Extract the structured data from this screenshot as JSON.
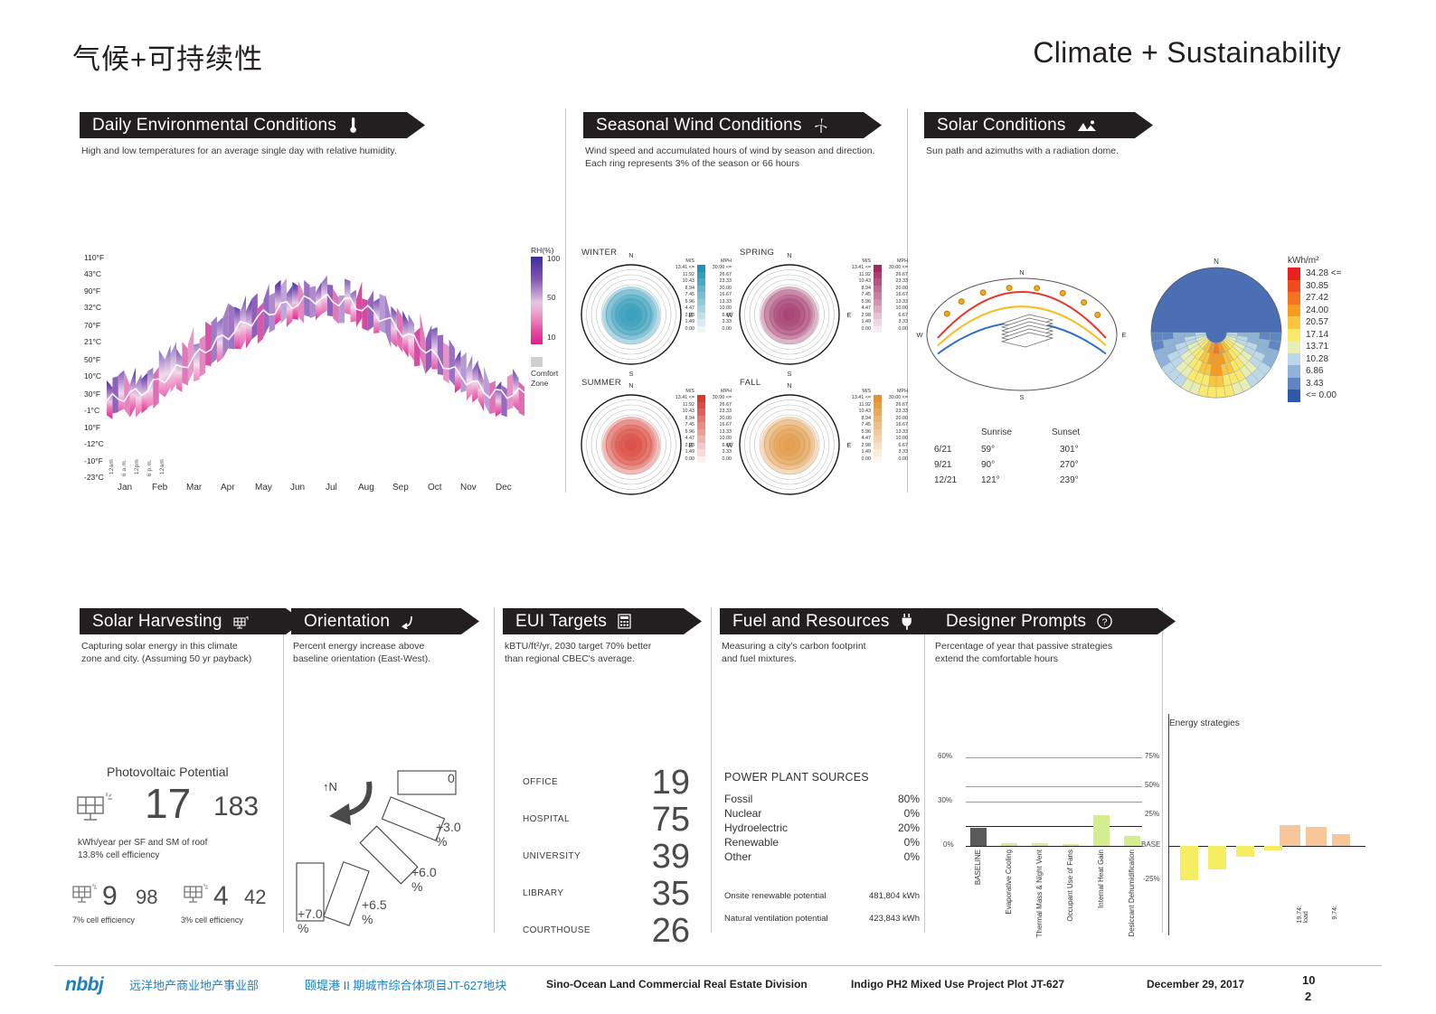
{
  "header": {
    "title_cn": "气候+可持续性",
    "title_en": "Climate + Sustainability"
  },
  "panels": {
    "daily": {
      "title": "Daily Environmental Conditions",
      "icon": "thermometer-icon",
      "subtitle": "High and low temperatures for an average single day with relative humidity."
    },
    "wind": {
      "title": "Seasonal Wind Conditions",
      "icon": "wind-turbine-icon",
      "subtitle": "Wind speed and accumulated hours of wind by season and direction.\nEach ring represents 3% of the season or 66 hours"
    },
    "solar": {
      "title": "Solar Conditions",
      "icon": "mountain-sun-icon",
      "subtitle": "Sun path and azimuths with a radiation dome."
    },
    "harvest": {
      "title": "Solar Harvesting",
      "icon": "solar-panel-icon",
      "subtitle": "Capturing solar energy in this climate\nzone and city. (Assuming 50 yr payback)"
    },
    "orientation": {
      "title": "Orientation",
      "icon": "rotate-arrow-icon",
      "subtitle": "Percent energy increase above\nbaseline orientation (East-West)."
    },
    "eui": {
      "title": "EUI Targets",
      "icon": "calculator-icon",
      "subtitle": "kBTU/ft²/yr, 2030 target 70% better\nthan regional CBEC's average."
    },
    "fuel": {
      "title": "Fuel and Resources",
      "icon": "plug-icon",
      "subtitle": "Measuring a city's carbon footprint\nand fuel mixtures."
    },
    "prompts": {
      "title": "Designer Prompts",
      "icon": "question-mark-icon",
      "subtitle": "Percentage of year that passive strategies\nextend the comfortable hours"
    }
  },
  "chart_data": [
    {
      "type": "area",
      "name": "daily-environmental-conditions",
      "title": "Daily Environmental Conditions",
      "xlabel": "",
      "ylabel": "Temperature",
      "y_ticks": [
        {
          "f": "110°F",
          "c": "43°C"
        },
        {
          "f": "90°F",
          "c": "32°C"
        },
        {
          "f": "70°F",
          "c": "21°C"
        },
        {
          "f": "50°F",
          "c": "10°C"
        },
        {
          "f": "30°F",
          "c": "-1°C"
        },
        {
          "f": "10°F",
          "c": "-12°C"
        },
        {
          "f": "-10°F",
          "c": "-23°C"
        }
      ],
      "categories": [
        "Jan",
        "Feb",
        "Mar",
        "Apr",
        "May",
        "Jun",
        "Jul",
        "Aug",
        "Sep",
        "Oct",
        "Nov",
        "Dec"
      ],
      "hour_ticks": [
        "12am",
        "6 a.m.",
        "12pm",
        "6 p.m.",
        "12am"
      ],
      "monthly_high_f": [
        34,
        40,
        52,
        66,
        78,
        86,
        89,
        87,
        79,
        66,
        50,
        38
      ],
      "monthly_low_f": [
        16,
        20,
        31,
        44,
        56,
        66,
        72,
        70,
        60,
        45,
        31,
        20
      ],
      "legend": {
        "title": "RH(%)",
        "ticks": [
          "100",
          "50",
          "10"
        ],
        "comfort_label": "Comfort\nZone"
      }
    },
    {
      "type": "windrose",
      "name": "seasonal-wind-conditions",
      "seasons": [
        "WINTER",
        "SPRING",
        "SUMMER",
        "FALL"
      ],
      "cardinals": [
        "N",
        "E",
        "S",
        "W"
      ],
      "ring_note": "Each ring represents 3% of the season or 66 hours",
      "legend_headers": [
        "M/S",
        "MPH"
      ],
      "ms_values": [
        "13.41 <=",
        "11.92",
        "10.43",
        "8.94",
        "7.45",
        "5.96",
        "4.47",
        "2.98",
        "1.49",
        "0.00"
      ],
      "mph_values": [
        "30.00 <=",
        "26.67",
        "23.33",
        "20.00",
        "16.67",
        "13.33",
        "10.00",
        "6.67",
        "3.33",
        "0.00"
      ],
      "season_colors": {
        "WINTER": "#1f93b5",
        "SPRING": "#9e2b62",
        "SUMMER": "#d83a2e",
        "FALL": "#e0933a"
      }
    },
    {
      "type": "sunpath",
      "name": "solar-conditions",
      "table_headers": [
        "",
        "Sunrise",
        "Sunset"
      ],
      "rows": [
        {
          "date": "6/21",
          "sunrise": "59°",
          "sunset": "301°"
        },
        {
          "date": "9/21",
          "sunrise": "90°",
          "sunset": "270°"
        },
        {
          "date": "12/21",
          "sunrise": "121°",
          "sunset": "239°"
        }
      ],
      "radiation_legend": {
        "title": "kWh/m²",
        "entries": [
          {
            "label": "34.28 <=",
            "color": "#e8211c"
          },
          {
            "label": "30.85",
            "color": "#f04b1e"
          },
          {
            "label": "27.42",
            "color": "#f4731f"
          },
          {
            "label": "24.00",
            "color": "#f79a20"
          },
          {
            "label": "20.57",
            "color": "#fac63f"
          },
          {
            "label": "17.14",
            "color": "#fbe96b"
          },
          {
            "label": "13.71",
            "color": "#e7edb4"
          },
          {
            "label": "10.28",
            "color": "#bcd7e8"
          },
          {
            "label": "6.86",
            "color": "#8fb3d8"
          },
          {
            "label": "3.43",
            "color": "#5f86c2"
          },
          {
            "label": "<= 0.00",
            "color": "#2f5aa8"
          }
        ]
      }
    },
    {
      "type": "bar",
      "name": "designer-prompts-passive-strategies",
      "title": "",
      "ylabel": "",
      "ylim": [
        -10,
        70
      ],
      "y_ticks": [
        "60%",
        "30%",
        "0%"
      ],
      "categories": [
        "BASELINE",
        "Evaporative Cooling",
        "Thermal Mass & Night Vent",
        "Occupant Use of Fans",
        "Internal Heat Gain",
        "Desiccant Dehumidification"
      ],
      "values": [
        13,
        1,
        1,
        0.5,
        24,
        7
      ],
      "baseline_color": "#5a5a5a",
      "bar_color": "#d4ed8e"
    },
    {
      "type": "bar",
      "name": "energy-strategies",
      "title": "Energy strategies",
      "ylim": [
        -37,
        87
      ],
      "y_ticks": [
        "75%",
        "50%",
        "25%",
        "BASE",
        "-25%"
      ],
      "categories": [
        "",
        "",
        "",
        "",
        "",
        "",
        ""
      ],
      "values": [
        -22,
        -15,
        -7,
        -2,
        13,
        12,
        7
      ],
      "negative_color": "#f5ee62",
      "positive_color": "#f7c79a",
      "annotations": [
        "19.74:\nload",
        "9.74:"
      ]
    }
  ],
  "harvest": {
    "pv_title": "Photovoltaic Potential",
    "primary_sf": "17",
    "primary_sm": "183",
    "primary_note": "kWh/year per SF and SM of roof\n13.8% cell efficiency",
    "alt": [
      {
        "sf": "9",
        "sm": "98",
        "note": "7% cell efficiency"
      },
      {
        "sf": "4",
        "sm": "42",
        "note": "3% cell efficiency"
      }
    ]
  },
  "orientation_data": {
    "north_label": "N",
    "steps": [
      "0",
      "+3.0\n%",
      "+6.0\n%",
      "+6.5\n%",
      "+7.0\n%"
    ]
  },
  "eui_data": {
    "rows": [
      {
        "name": "OFFICE",
        "value": "19"
      },
      {
        "name": "HOSPITAL",
        "value": "75"
      },
      {
        "name": "UNIVERSITY",
        "value": "39"
      },
      {
        "name": "LIBRARY",
        "value": "35"
      },
      {
        "name": "COURTHOUSE",
        "value": "26"
      }
    ]
  },
  "fuel_data": {
    "heading": "POWER PLANT SOURCES",
    "sources": [
      {
        "name": "Fossil",
        "value": "80%"
      },
      {
        "name": "Nuclear",
        "value": "0%"
      },
      {
        "name": "Hydroelectric",
        "value": "20%"
      },
      {
        "name": "Renewable",
        "value": "0%"
      },
      {
        "name": "Other",
        "value": "0%"
      }
    ],
    "resources": [
      {
        "name": "Onsite renewable potential",
        "value": "481,804 kWh"
      },
      {
        "name": "Natural ventilation potential",
        "value": "423,843 kWh"
      }
    ]
  },
  "footer": {
    "logo": "nbbj",
    "client_cn": "远洋地产商业地产事业部",
    "project_cn": "颐堤港 II 期城市综合体项目JT-627地块",
    "client_en": "Sino-Ocean Land Commercial Real Estate Division",
    "project_en": "Indigo PH2 Mixed Use Project Plot JT-627",
    "date": "December 29, 2017",
    "page_top": "10",
    "page_bottom": "2"
  }
}
